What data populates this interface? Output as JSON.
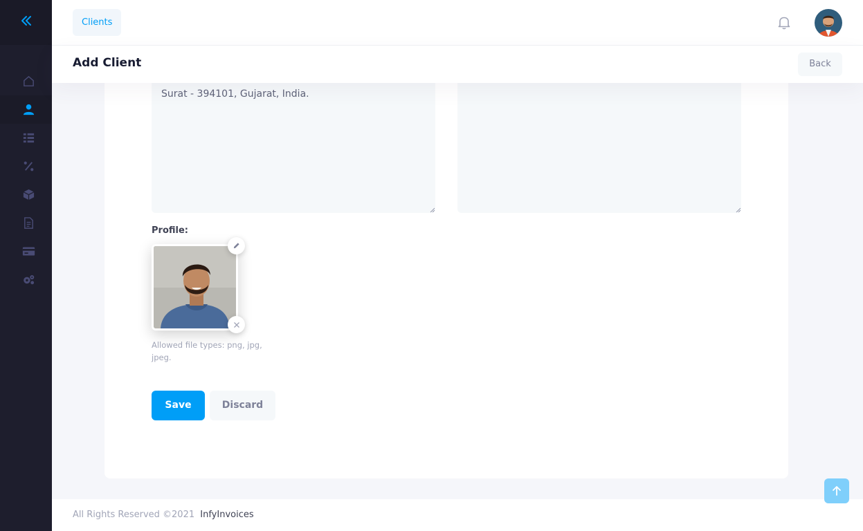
{
  "colors": {
    "accent": "#009ef7",
    "sidebar_bg": "#1e1e2d",
    "sidebar_icon": "#494b74"
  },
  "sidebar": {
    "toggle_icon": "double-chevron-left-icon",
    "items": [
      {
        "icon": "home-icon",
        "active": false
      },
      {
        "icon": "user-icon",
        "active": true
      },
      {
        "icon": "list-icon",
        "active": false
      },
      {
        "icon": "percent-icon",
        "active": false
      },
      {
        "icon": "box-icon",
        "active": false
      },
      {
        "icon": "document-icon",
        "active": false
      },
      {
        "icon": "credit-card-icon",
        "active": false
      },
      {
        "icon": "gears-icon",
        "active": false
      }
    ]
  },
  "header": {
    "breadcrumb": "Clients",
    "notification_icon": "bell-icon",
    "avatar_icon": "user-avatar"
  },
  "toolbar": {
    "title": "Add Client",
    "back_label": "Back"
  },
  "form": {
    "address_line_partial": "",
    "address_line": "Surat - 394101, Gujarat, India.",
    "profile_label": "Profile:",
    "allowed_types": "Allowed file types: png, jpg, jpeg.",
    "save_label": "Save",
    "discard_label": "Discard"
  },
  "footer": {
    "copyright": "All Rights Reserved ©2021",
    "brand": "InfyInvoices"
  }
}
